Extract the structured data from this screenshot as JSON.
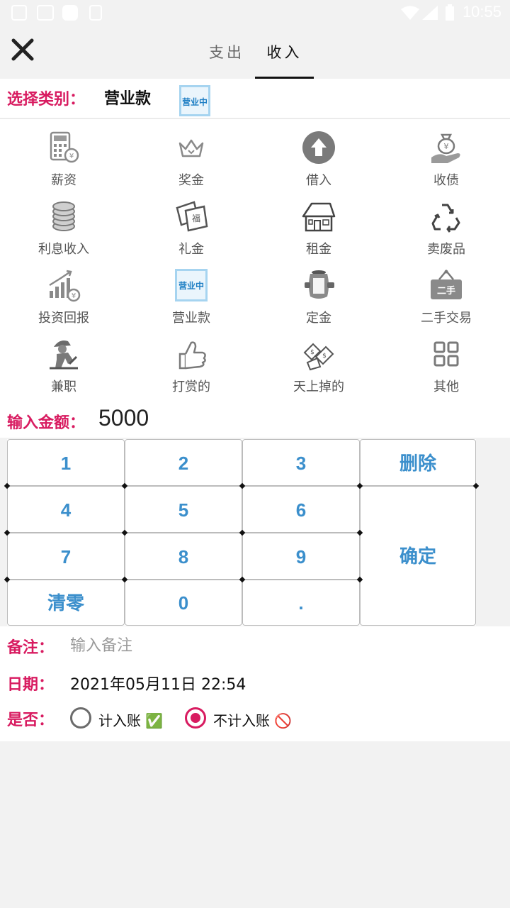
{
  "status_bar": {
    "time": "10:55"
  },
  "header": {
    "tabs": [
      {
        "label": "支出",
        "active": false
      },
      {
        "label": "收入",
        "active": true
      }
    ]
  },
  "category": {
    "label": "选择类别：",
    "selected": "营业款",
    "selected_icon": "business-open-sign-icon"
  },
  "categories": [
    {
      "label": "薪资",
      "icon": "calculator-yen-icon"
    },
    {
      "label": "奖金",
      "icon": "crown-icon"
    },
    {
      "label": "借入",
      "icon": "arrow-up-circle-icon"
    },
    {
      "label": "收债",
      "icon": "money-bag-hand-icon"
    },
    {
      "label": "利息收入",
      "icon": "coin-stack-icon"
    },
    {
      "label": "礼金",
      "icon": "red-envelope-icon"
    },
    {
      "label": "租金",
      "icon": "house-icon"
    },
    {
      "label": "卖废品",
      "icon": "recycle-icon"
    },
    {
      "label": "投资回报",
      "icon": "growth-chart-icon"
    },
    {
      "label": "营业款",
      "icon": "business-open-sign-icon",
      "sign_text": "营业中"
    },
    {
      "label": "定金",
      "icon": "deposit-jar-icon"
    },
    {
      "label": "二手交易",
      "icon": "second-hand-sign-icon",
      "sign_text": "二手"
    },
    {
      "label": "兼职",
      "icon": "worker-icon"
    },
    {
      "label": "打赏的",
      "icon": "thumbs-up-icon"
    },
    {
      "label": "天上掉的",
      "icon": "falling-money-icon"
    },
    {
      "label": "其他",
      "icon": "grid-four-icon"
    }
  ],
  "amount": {
    "label": "输入金额：",
    "value": "5000"
  },
  "keypad": {
    "digits": [
      "1",
      "2",
      "3",
      "4",
      "5",
      "6",
      "7",
      "8",
      "9",
      "0",
      "."
    ],
    "delete_label": "删除",
    "confirm_label": "确定",
    "clear_label": "清零"
  },
  "note": {
    "label": "备注：",
    "placeholder": "输入备注",
    "value": ""
  },
  "date": {
    "label": "日期：",
    "value": "2021年05月11日 22:54"
  },
  "account": {
    "label": "是否：",
    "options": [
      {
        "label": "计入账 ✅",
        "selected": false
      },
      {
        "label": "不计入账 🚫",
        "selected": true
      }
    ]
  },
  "colors": {
    "accent": "#d81b60",
    "key_text": "#3b8fcc",
    "background": "#f2f2f2"
  }
}
